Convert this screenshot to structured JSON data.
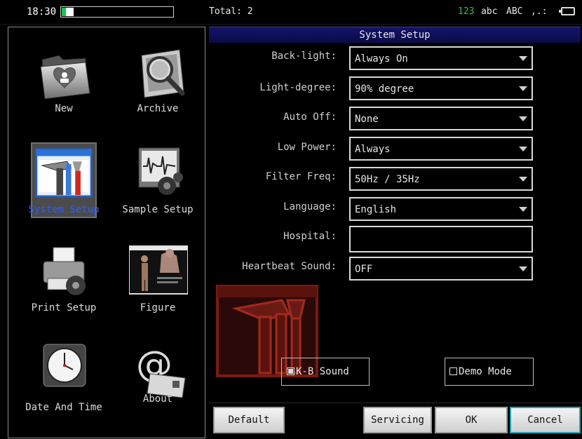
{
  "status": {
    "time": "18:30",
    "battery_level": 0.11,
    "total": "Total: 2",
    "input_modes": [
      "123",
      "abc",
      "ABC",
      ",.:"
    ],
    "active_input_mode": "123"
  },
  "menu": {
    "items": [
      {
        "label": "New",
        "icon": "folder-patient-icon"
      },
      {
        "label": "Archive",
        "icon": "magnifier-folder-icon"
      },
      {
        "label": "System Setup",
        "icon": "tools-window-icon",
        "selected": true
      },
      {
        "label": "Sample Setup",
        "icon": "waveform-gear-icon"
      },
      {
        "label": "Print Setup",
        "icon": "printer-gear-icon"
      },
      {
        "label": "Figure",
        "icon": "body-figure-icon"
      },
      {
        "label": "Date And Time",
        "icon": "clock-icon"
      },
      {
        "label": "About",
        "icon": "at-envelope-icon"
      }
    ]
  },
  "dialog": {
    "title": "System Setup",
    "fields": [
      {
        "label": "Back-light:",
        "value": "Always On",
        "type": "select"
      },
      {
        "label": "Light-degree:",
        "value": "90% degree",
        "type": "select"
      },
      {
        "label": "Auto Off:",
        "value": "None",
        "type": "select"
      },
      {
        "label": "Low Power:",
        "value": "Always",
        "type": "select"
      },
      {
        "label": "Filter Freq:",
        "value": "50Hz / 35Hz",
        "type": "select"
      },
      {
        "label": "Language:",
        "value": "English",
        "type": "select"
      },
      {
        "label": "Hospital:",
        "value": "",
        "type": "text"
      },
      {
        "label": "Heartbeat Sound:",
        "value": "OFF",
        "type": "select"
      }
    ],
    "checkboxes": [
      {
        "label": "K-B Sound",
        "checked": true
      },
      {
        "label": "Demo Mode",
        "checked": false
      }
    ],
    "buttons": {
      "default": "Default",
      "servicing": "Servicing",
      "ok": "OK",
      "cancel": "Cancel"
    },
    "watermark_icon": "tools-watermark-icon"
  },
  "colors": {
    "accent_blue": "#0a0a48",
    "selected_label": "#2f5cff",
    "input_mode_active": "#28c840",
    "cancel_border": "#1fa8b4",
    "watermark_red": "#7a1a12"
  }
}
